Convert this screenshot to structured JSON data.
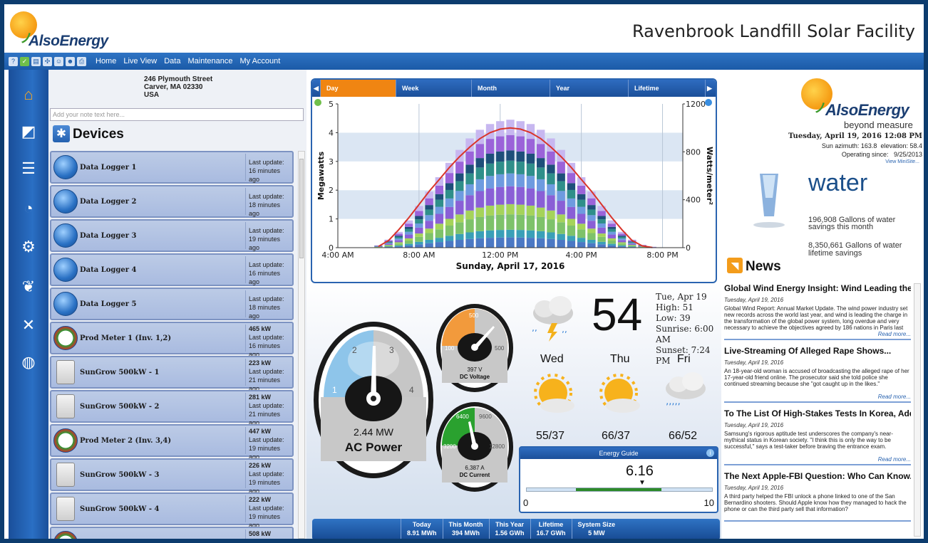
{
  "header": {
    "brand": "AlsoEnergy",
    "site_title": "Ravenbrook Landfill Solar Facility"
  },
  "menubar": {
    "icons": [
      "help-icon",
      "check-icon",
      "document-icon",
      "settings-icon",
      "user-icon",
      "users-icon",
      "print-icon"
    ],
    "items": [
      "Home",
      "Live View",
      "Data",
      "Maintenance",
      "My Account"
    ]
  },
  "leftnav": {
    "buttons": [
      "home-icon",
      "chart-icon",
      "report-icon",
      "gauge-icon",
      "globe-settings-icon",
      "leaf-icon",
      "tools-icon",
      "earth-icon"
    ]
  },
  "address": {
    "line1": "246 Plymouth Street",
    "line2": "Carver, MA 02330",
    "line3": "USA"
  },
  "note": {
    "placeholder": "Add your note text here..."
  },
  "devices": {
    "title": "Devices",
    "rows": [
      {
        "name": "Data Logger 1",
        "type": "logger",
        "l1": "Last update:",
        "l2": "16 minutes ago",
        "kw": ""
      },
      {
        "name": "Data Logger 2",
        "type": "logger",
        "l1": "Last update:",
        "l2": "18 minutes ago",
        "kw": ""
      },
      {
        "name": "Data Logger 3",
        "type": "logger",
        "l1": "Last update:",
        "l2": "19 minutes ago",
        "kw": ""
      },
      {
        "name": "Data Logger 4",
        "type": "logger",
        "l1": "Last update:",
        "l2": "16 minutes ago",
        "kw": ""
      },
      {
        "name": "Data Logger 5",
        "type": "logger",
        "l1": "Last update:",
        "l2": "18 minutes ago",
        "kw": ""
      },
      {
        "name": "Prod Meter 1 (Inv. 1,2)",
        "type": "meter",
        "l1": "Last update:",
        "l2": "16 minutes ago",
        "kw": "465 kW"
      },
      {
        "name": "SunGrow 500kW - 1",
        "type": "inverter",
        "l1": "Last update:",
        "l2": "21 minutes ago",
        "kw": "223 kW"
      },
      {
        "name": "SunGrow 500kW - 2",
        "type": "inverter",
        "l1": "Last update:",
        "l2": "21 minutes ago",
        "kw": "281 kW"
      },
      {
        "name": "Prod Meter 2 (Inv. 3,4)",
        "type": "meter",
        "l1": "Last update:",
        "l2": "19 minutes ago",
        "kw": "447 kW"
      },
      {
        "name": "SunGrow 500kW - 3",
        "type": "inverter",
        "l1": "Last update:",
        "l2": "19 minutes ago",
        "kw": "226 kW"
      },
      {
        "name": "SunGrow 500kW - 4",
        "type": "inverter",
        "l1": "Last update:",
        "l2": "19 minutes ago",
        "kw": "222 kW"
      },
      {
        "name": "",
        "type": "meter",
        "l1": "",
        "l2": "",
        "kw": "508 kW"
      }
    ]
  },
  "tabs": [
    "Day",
    "Week",
    "Month",
    "Year",
    "Lifetime"
  ],
  "active_tab": "Day",
  "chart_data": {
    "type": "bar",
    "title": "",
    "xlabel": "Sunday, April 17, 2016",
    "ylabel": "Megawatts",
    "y2label": "Watts/meter²",
    "x_ticks": [
      "4:00 AM",
      "8:00 AM",
      "12:00 PM",
      "4:00 PM",
      "8:00 PM"
    ],
    "x_tick_hours": [
      4,
      8,
      12,
      16,
      20
    ],
    "xlim_hours": [
      4,
      21
    ],
    "y_ticks": [
      0,
      1,
      2,
      3,
      4,
      5
    ],
    "ylim": [
      0,
      5
    ],
    "y2_ticks": [
      0,
      400,
      800,
      1200
    ],
    "y2lim": [
      0,
      1200
    ],
    "x_hours": [
      6.0,
      6.5,
      7.0,
      7.5,
      8.0,
      8.5,
      9.0,
      9.5,
      10.0,
      10.5,
      11.0,
      11.5,
      12.0,
      12.5,
      13.0,
      13.5,
      14.0,
      14.5,
      15.0,
      15.5,
      16.0,
      16.5,
      17.0,
      17.5,
      18.0,
      18.5,
      19.0,
      19.5
    ],
    "series": [
      {
        "name": "",
        "color": "#4b78c4",
        "share": 0.08
      },
      {
        "name": "",
        "color": "#3aa0b8",
        "share": 0.06
      },
      {
        "name": "",
        "color": "#7ec26a",
        "share": 0.12
      },
      {
        "name": "",
        "color": "#a5d35a",
        "share": 0.08
      },
      {
        "name": "",
        "color": "#8a5fd6",
        "share": 0.14
      },
      {
        "name": "",
        "color": "#6e9be0",
        "share": 0.1
      },
      {
        "name": "",
        "color": "#2f8f8a",
        "share": 0.1
      },
      {
        "name": "",
        "color": "#1e4f7a",
        "share": 0.08
      },
      {
        "name": "",
        "color": "#9b63d9",
        "share": 0.12
      },
      {
        "name": "",
        "color": "#c7b7f0",
        "share": 0.12
      }
    ],
    "totals_mw": [
      0.08,
      0.28,
      0.55,
      0.95,
      1.45,
      1.95,
      2.45,
      2.95,
      3.4,
      3.8,
      4.1,
      4.3,
      4.4,
      4.45,
      4.4,
      4.3,
      4.1,
      3.8,
      3.4,
      2.95,
      2.45,
      1.95,
      1.45,
      0.95,
      0.55,
      0.28,
      0.1,
      0.03
    ],
    "irradiance_wm2": [
      10,
      60,
      150,
      250,
      360,
      470,
      570,
      670,
      760,
      840,
      910,
      960,
      990,
      1000,
      990,
      960,
      910,
      840,
      760,
      670,
      570,
      470,
      360,
      250,
      150,
      60,
      15,
      2
    ]
  },
  "gauges": {
    "ac": {
      "value": "2.44 MW",
      "label": "AC Power",
      "ticks": [
        "1",
        "2",
        "3",
        "4"
      ]
    },
    "dcv": {
      "value": "397 V",
      "label": "DC Voltage",
      "ticks": [
        "100",
        "500",
        "500"
      ]
    },
    "dca": {
      "value": "6,387 A",
      "label": "DC Current",
      "ticks": [
        "3200",
        "6400",
        "9600",
        "12800"
      ]
    }
  },
  "weather": {
    "date": "Tue, Apr 19",
    "high": "High: 51",
    "low": "Low: 39",
    "sunrise": "Sunrise: 6:00 AM",
    "sunset": "Sunset: 7:24 PM",
    "temp": "54",
    "forecast": [
      {
        "day": "Wed",
        "range": "55/37"
      },
      {
        "day": "Thu",
        "range": "66/37"
      },
      {
        "day": "Fri",
        "range": "66/52"
      }
    ]
  },
  "energy_guide": {
    "title": "Energy Guide",
    "value": "6.16",
    "min": "0",
    "max": "10",
    "level": 6.16
  },
  "totals": [
    {
      "label": "Today",
      "value": "8.91 MWh"
    },
    {
      "label": "This Month",
      "value": "394 MWh"
    },
    {
      "label": "This Year",
      "value": "1.56 GWh"
    },
    {
      "label": "Lifetime",
      "value": "16.7 GWh"
    },
    {
      "label": "System Size",
      "value": "5 MW"
    }
  ],
  "right": {
    "brand": "AlsoEnergy",
    "tagline": "beyond measure",
    "datetime": "Tuesday, April 19, 2016 12:08 PM",
    "sun": "Sun azimuth: 163.8  elevation: 58.4",
    "operating": "Operating since:   9/25/2013",
    "minisite": "View MiniSite...",
    "water_title": "water",
    "water_month": "196,908 Gallons of water savings this month",
    "water_lifetime": "8,350,661 Gallons of water lifetime savings",
    "news_title": "News"
  },
  "news": [
    {
      "title": "Global Wind Energy Insight: Wind Leading the...",
      "date": "Tuesday, April 19, 2016",
      "body": "Global Wind Report: Annual Market Update. The wind power industry set new records across the world last year, and wind is leading the charge in the transformation of the global power system, long overdue and very necessary to achieve the objectives agreed by 186 nations in Paris last December.",
      "more": "Read more..."
    },
    {
      "title": "Live-Streaming Of Alleged Rape Shows...",
      "date": "Tuesday, April 19, 2016",
      "body": "An 18-year-old woman is accused of broadcasting the alleged rape of her 17-year-old friend online. The prosecutor said she told police she continued streaming because she \"got caught up in the likes.\"",
      "more": "Read more..."
    },
    {
      "title": "To The List Of High-Stakes Tests In Korea, Add...",
      "date": "Tuesday, April 19, 2016",
      "body": "Samsung's rigorous aptitude test underscores the company's near-mythical status in Korean society. \"I think this is only the way to be successful,\" says a test-taker before braving the entrance exam.",
      "more": "Read more..."
    },
    {
      "title": "The Next Apple-FBI Question: Who Can Know...",
      "date": "Tuesday, April 19, 2016",
      "body": "A third party helped the FBI unlock a phone linked to one of the San Bernardino shooters. Should Apple know how they managed to hack the phone or can the third party sell that information?",
      "more": ""
    }
  ]
}
